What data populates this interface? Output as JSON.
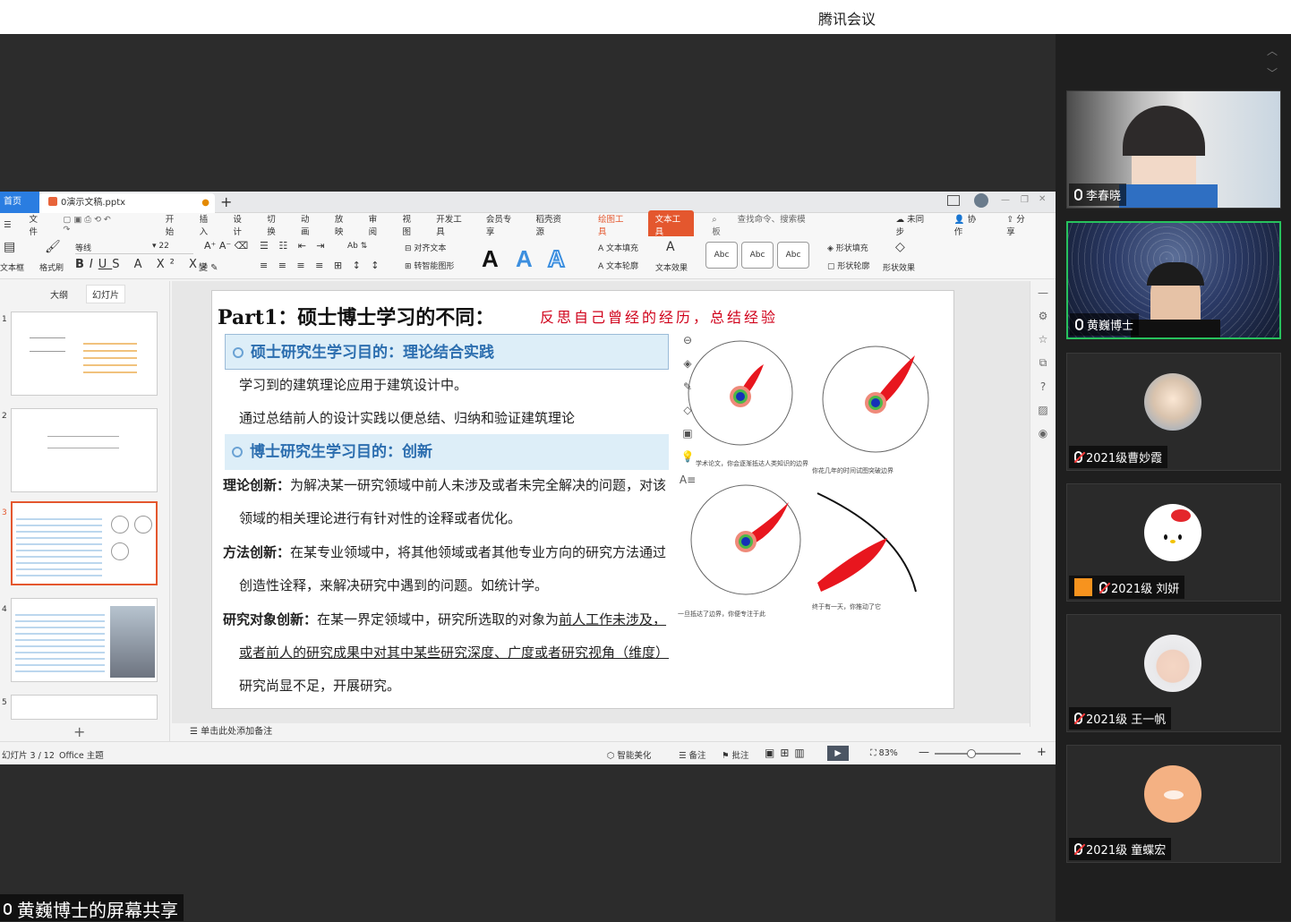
{
  "app": {
    "title": "腾讯会议"
  },
  "participants": [
    {
      "name": "李春晓",
      "mic": "on",
      "active": false
    },
    {
      "name": "黄巍博士",
      "mic": "on",
      "active": true
    },
    {
      "name": "2021级曹妙霞",
      "mic": "off",
      "active": false
    },
    {
      "name": "2021级 刘妍",
      "mic": "off",
      "active": false
    },
    {
      "name": "2021级 王一帆",
      "mic": "off",
      "active": false
    },
    {
      "name": "2021级 童蝶宏",
      "mic": "off",
      "active": false
    }
  ],
  "screenshare": {
    "label": "黄巍博士的屏幕共享"
  },
  "wps": {
    "home_tab": "首页",
    "doc_tab": "0演示文稿.pptx",
    "file_menu": "文件",
    "menus": [
      "开始",
      "插入",
      "设计",
      "切换",
      "动画",
      "放映",
      "审阅",
      "视图",
      "开发工具",
      "会员专享",
      "稻壳资源"
    ],
    "draw_tools": "绘图工具",
    "text_tools": "文本工具",
    "search_placeholder": "查找命令、搜索模板",
    "sync": "未同步",
    "collab": "协作",
    "share": "分享",
    "font_name": "等线",
    "font_size": "22",
    "toolbar": {
      "textbox": "文本框",
      "format_painter": "格式刷",
      "align_text": "对齐文本",
      "smartart": "转智能图形",
      "text_fill": "文本填充",
      "text_outline": "文本轮廓",
      "text_effect": "文本效果",
      "shape_fill": "形状填充",
      "shape_outline": "形状轮廓",
      "shape_effect": "形状效果",
      "abc1": "Abc",
      "abc2": "Abc",
      "abc3": "Abc"
    },
    "left_tabs": {
      "outline": "大纲",
      "slides": "幻灯片"
    },
    "thumb_nums": [
      "1",
      "2",
      "3",
      "4",
      "5"
    ],
    "notes_placeholder": "单击此处添加备注",
    "status": {
      "slide_pos": "幻灯片 3 / 12",
      "theme": "Office 主题",
      "beautify": "智能美化",
      "notes": "备注",
      "comments": "批注",
      "zoom": "83%"
    }
  },
  "slide": {
    "title": "Part1：硕士博士学习的不同：",
    "subtitle": "反思自己曾经的经历，总结经验",
    "band1": "硕士研究生学习目的：理论结合实践",
    "line1": "学习到的建筑理论应用于建筑设计中。",
    "line2": "通过总结前人的设计实践以便总结、归纳和验证建筑理论",
    "band2": "博士研究生学习目的：创新",
    "t1_label": "理论创新：",
    "t1_text": "为解决某一研究领域中前人未涉及或者未完全解决的问题，对该",
    "t1_cont": "领域的相关理论进行有针对性的诠释或者优化。",
    "t2_label": "方法创新：",
    "t2_text": "在某专业领域中，将其他领域或者其他专业方向的研究方法通过",
    "t2_cont": "创造性诠释，来解决研究中遇到的问题。如统计学。",
    "t3_label": "研究对象创新：",
    "t3_text_a": "在某一界定领域中，研究所选取的对象为",
    "t3_text_b": "前人工作未涉及，",
    "t3_cont": "或者前人的研究成果中对其中某些研究深度、广度或者研究视角（维度）",
    "t3_end": "研究尚显不足，开展研究。",
    "cap1": "学术论文，你会逐渐抵达人类知识的边界",
    "cap2": "你花几年的时间试图突破边界",
    "cap3": "一旦抵达了边界，你便专注于此",
    "cap4": "终于有一天，你推动了它"
  },
  "colors": {
    "accent": "#e4572e",
    "band": "#ddeef8",
    "band_text": "#2c6eaf",
    "subtitle": "#d0021b",
    "active_tile": "#27c15d"
  }
}
